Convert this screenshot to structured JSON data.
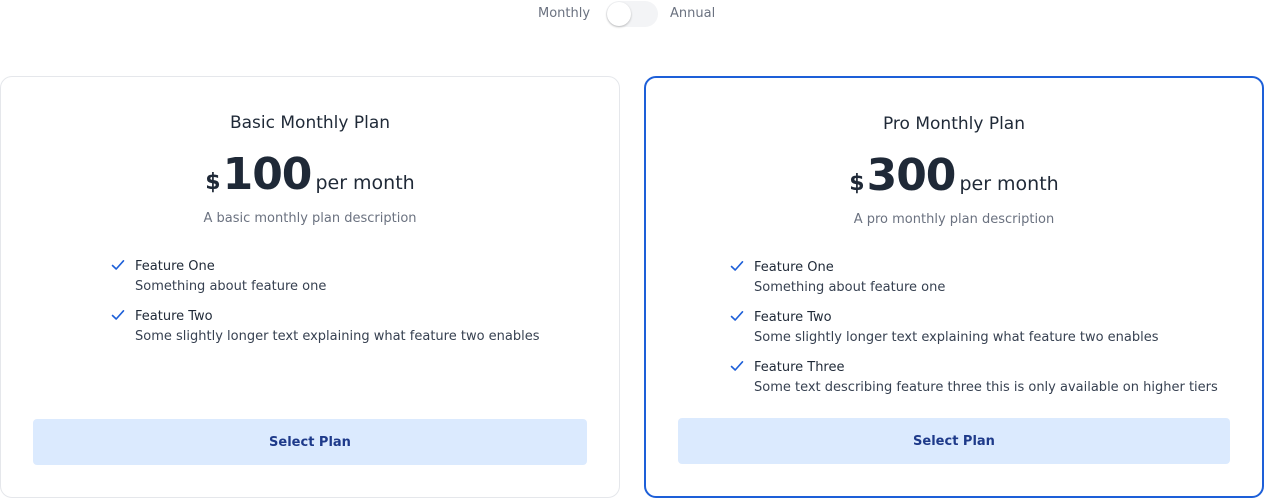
{
  "billing_toggle": {
    "monthly_label": "Monthly",
    "annual_label": "Annual",
    "selected": "Monthly"
  },
  "plans": [
    {
      "title": "Basic Monthly Plan",
      "currency": "$",
      "price": "100",
      "period": "per month",
      "description": "A basic monthly plan description",
      "features": [
        {
          "name": "Feature One",
          "detail": "Something about feature one"
        },
        {
          "name": "Feature Two",
          "detail": "Some slightly longer text explaining what feature two enables"
        }
      ],
      "button_label": "Select Plan",
      "highlighted": false
    },
    {
      "title": "Pro Monthly Plan",
      "currency": "$",
      "price": "300",
      "period": "per month",
      "description": "A pro monthly plan description",
      "features": [
        {
          "name": "Feature One",
          "detail": "Something about feature one"
        },
        {
          "name": "Feature Two",
          "detail": "Some slightly longer text explaining what feature two enables"
        },
        {
          "name": "Feature Three",
          "detail": "Some text describing feature three this is only available on higher tiers"
        }
      ],
      "button_label": "Select Plan",
      "highlighted": true
    }
  ],
  "colors": {
    "accent": "#1d5fd8",
    "button_bg": "#dbeafe",
    "button_text": "#1e3a8a",
    "check": "#1d5fd8"
  },
  "icons": {
    "feature_check": "check-icon"
  }
}
